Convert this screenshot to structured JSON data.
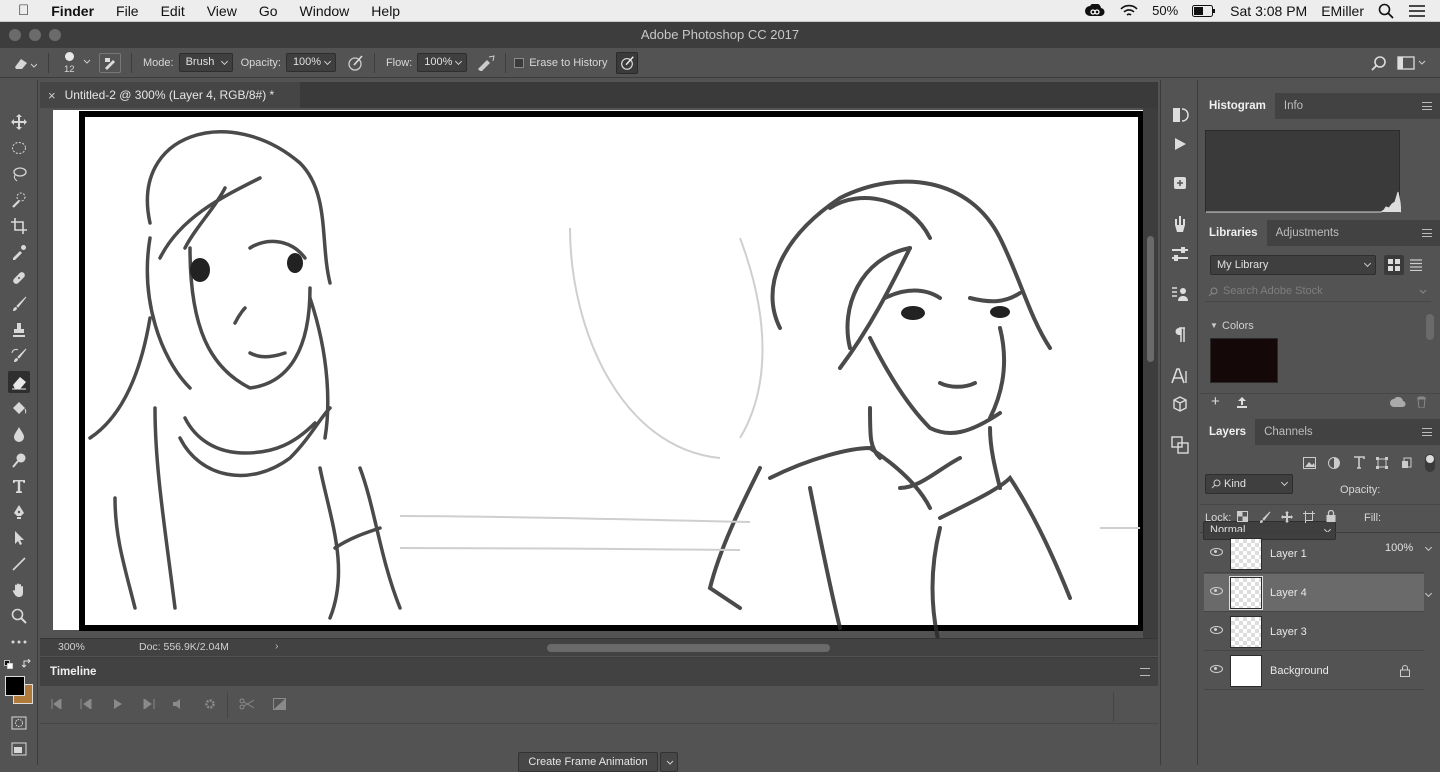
{
  "menubar": {
    "app": "Finder",
    "items": [
      "File",
      "Edit",
      "View",
      "Go",
      "Window",
      "Help"
    ],
    "battery": "50%",
    "clock": "Sat 3:08 PM",
    "user": "EMiller"
  },
  "window": {
    "title": "Adobe Photoshop CC 2017"
  },
  "options": {
    "brush_size": "12",
    "mode_label": "Mode:",
    "mode_value": "Brush",
    "opacity_label": "Opacity:",
    "opacity_value": "100%",
    "flow_label": "Flow:",
    "flow_value": "100%",
    "erase_history_label": "Erase to History"
  },
  "document": {
    "tab_title": "Untitled-2 @ 300% (Layer 4, RGB/8#) *",
    "zoom": "300%",
    "doc_info": "Doc: 556.9K/2.04M"
  },
  "timeline": {
    "title": "Timeline",
    "create_button": "Create Frame Animation"
  },
  "panels": {
    "top_tabs": [
      "Histogram",
      "Info"
    ],
    "lib_tabs": [
      "Libraries",
      "Adjustments"
    ],
    "library_select": "My Library",
    "search_placeholder": "Search Adobe Stock",
    "colors_label": "Colors",
    "swatch_color": "#140809",
    "layer_tabs": [
      "Layers",
      "Channels"
    ],
    "kind_filter": "Kind",
    "blend_mode": "Normal",
    "opacity_label": "Opacity:",
    "opacity_value": "100%",
    "lock_label": "Lock:",
    "fill_label": "Fill:",
    "fill_value": "100%",
    "layers": [
      {
        "name": "Layer 1",
        "selected": false
      },
      {
        "name": "Layer 4",
        "selected": true
      },
      {
        "name": "Layer 3",
        "selected": false
      },
      {
        "name": "Background",
        "selected": false
      }
    ]
  },
  "colors": {
    "foreground": "#000000",
    "background": "#b07a3a"
  }
}
